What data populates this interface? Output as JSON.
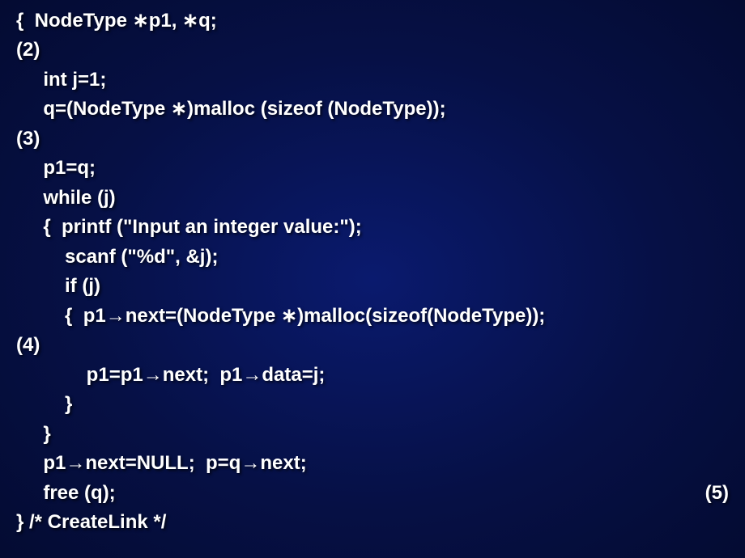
{
  "lines": {
    "l1": "{  NodeType ∗p1, ∗q;                                          (2)",
    "l2": "     int j=1;",
    "l3": "     q=(NodeType ∗)malloc (sizeof (NodeType));          (3)",
    "l4": "     p1=q;",
    "l5": "     while (j)",
    "l6": "     {  printf (\"Input an integer value:\");",
    "l7": "         scanf (\"%d\", &j);",
    "l8": "         if (j)",
    "l9": "         {  p1→next=(NodeType ∗)malloc(sizeof(NodeType));  (4)",
    "l10": "             p1=p1→next;  p1→data=j;",
    "l11": "         }",
    "l12": "     }",
    "l13": "     p1→next=NULL;  p=q→next;",
    "l14": "     free (q);                                                                  (5)",
    "l15": "} /* CreateLink */"
  },
  "markers": {
    "m2": "(2)",
    "m3": "(3)",
    "m4": "(4)",
    "m5": "(5)"
  },
  "code": {
    "decl": "{  NodeType ∗p1, ∗q;",
    "int_j": "     int j=1;",
    "malloc_q": "     q=(NodeType ∗)malloc (sizeof (NodeType));",
    "p1_q": "     p1=q;",
    "while": "     while (j)",
    "printf": "     {  printf (\"Input an integer value:\");",
    "scanf": "         scanf (\"%d\", &j);",
    "if_j": "         if (j)",
    "malloc_next": "         {  p1→next=(NodeType ∗)malloc(sizeof(NodeType));",
    "p1_next": "             p1=p1→next;  p1→data=j;",
    "close1": "         }",
    "close2": "     }",
    "null": "     p1→next=NULL;  p=q→next;",
    "free": "     free (q);",
    "end": "} /* CreateLink */"
  }
}
